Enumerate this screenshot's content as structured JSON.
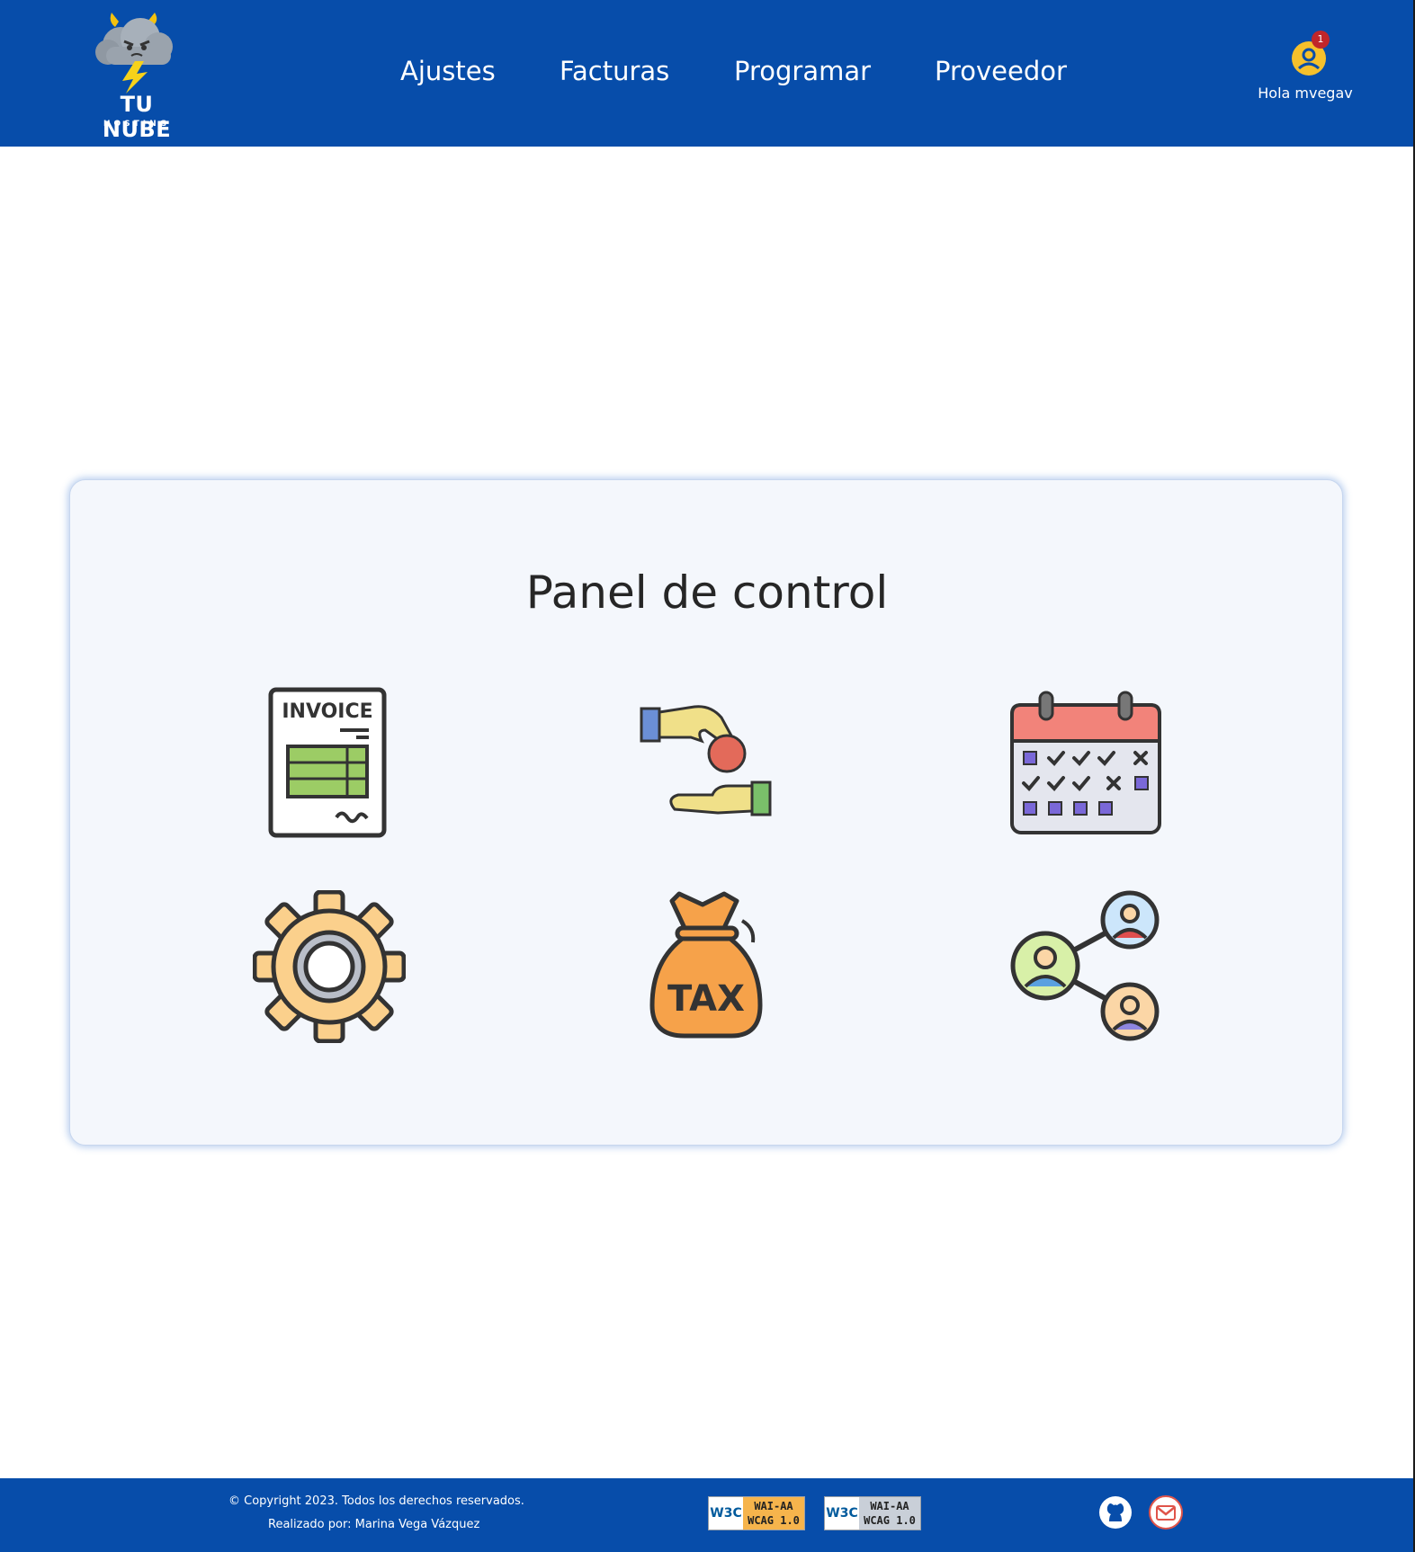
{
  "brand": {
    "name": "TU NUBE",
    "sub": "HOSTING"
  },
  "nav": {
    "items": [
      {
        "label": "Ajustes"
      },
      {
        "label": "Facturas"
      },
      {
        "label": "Programar"
      },
      {
        "label": "Proveedor"
      }
    ]
  },
  "user": {
    "greeting": "Hola mvegav",
    "notifications": "1"
  },
  "panel": {
    "title": "Panel de control",
    "tiles": [
      {
        "icon": "invoice-icon",
        "text": "INVOICE"
      },
      {
        "icon": "payment-hands-icon"
      },
      {
        "icon": "calendar-icon"
      },
      {
        "icon": "gear-icon"
      },
      {
        "icon": "tax-bag-icon",
        "text": "TAX"
      },
      {
        "icon": "user-network-icon"
      }
    ]
  },
  "footer": {
    "copyright": "© Copyright 2023. Todos los derechos reservados.",
    "author": "Realizado por: Marina Vega Vázquez",
    "badges": [
      {
        "logo": "W3C",
        "line1": "WAI-AA",
        "line2": "WCAG 1.0"
      },
      {
        "logo": "W3C",
        "line1": "WAI-AA",
        "line2": "WCAG 1.0"
      }
    ],
    "social": [
      "github-icon",
      "gmail-icon"
    ]
  },
  "colors": {
    "header": "#074daa",
    "card": "#f4f7fc",
    "badge": "#c0262a"
  }
}
